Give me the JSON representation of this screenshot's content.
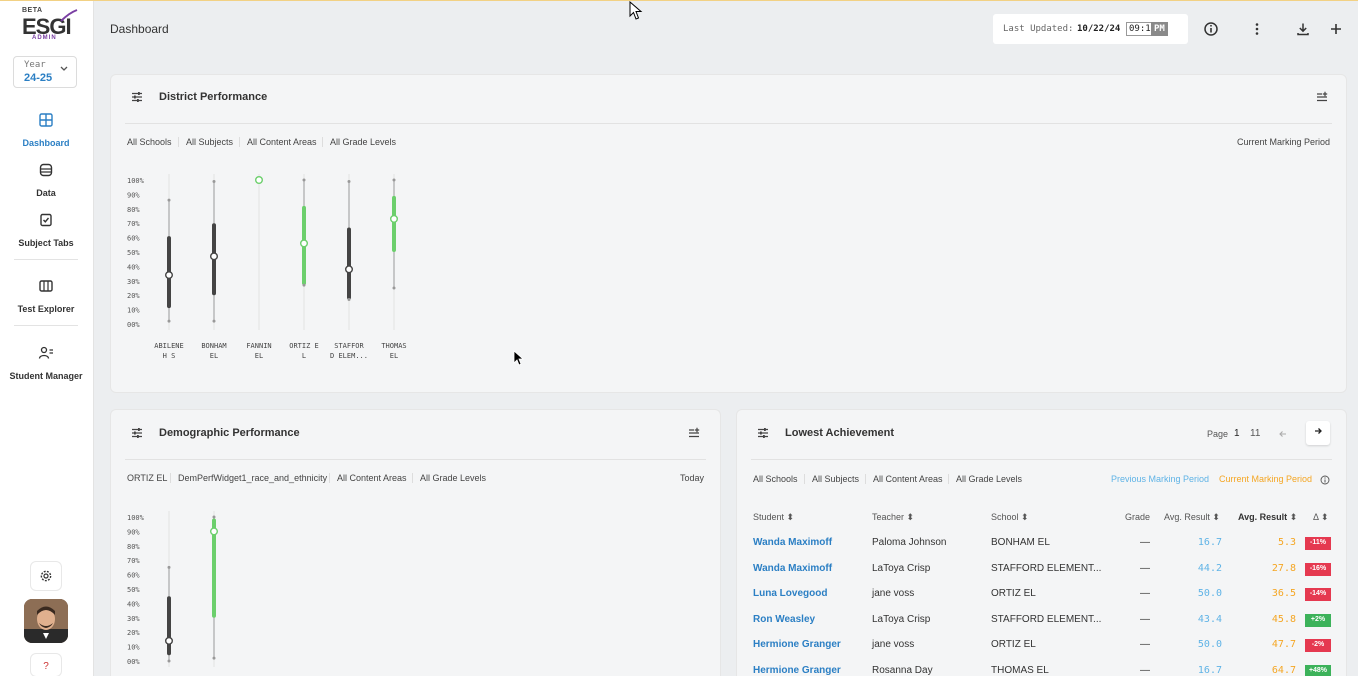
{
  "sidebar": {
    "logo": {
      "beta": "BETA",
      "name": "ESGI",
      "sub": "ADMIN"
    },
    "year": {
      "label": "Year",
      "value": "24-25"
    },
    "items": [
      {
        "label": "Dashboard",
        "icon": "dashboard-icon"
      },
      {
        "label": "Data",
        "icon": "data-icon"
      },
      {
        "label": "Subject Tabs",
        "icon": "subject-tabs-icon"
      },
      {
        "label": "Test Explorer",
        "icon": "test-explorer-icon"
      },
      {
        "label": "Student Manager",
        "icon": "student-manager-icon"
      }
    ],
    "help": "?"
  },
  "header": {
    "title": "Dashboard",
    "last_updated_label": "Last Updated:",
    "date": "10/22/24",
    "time": "09:19",
    "ampm": "PM"
  },
  "district": {
    "title": "District Performance",
    "filters": [
      "All Schools",
      "All Subjects",
      "All Content Areas",
      "All Grade Levels"
    ],
    "period": "Current Marking Period"
  },
  "demographic": {
    "title": "Demographic Performance",
    "filters": [
      "ORTIZ EL",
      "DemPerfWidget1_race_and_ethnicity",
      "All Content Areas",
      "All Grade Levels"
    ],
    "period": "Today"
  },
  "lowest": {
    "title": "Lowest Achievement",
    "page_label": "Page",
    "page": "1",
    "total_pages": "11",
    "filters": [
      "All Schools",
      "All Subjects",
      "All Content Areas",
      "All Grade Levels"
    ],
    "prev_period": "Previous Marking Period",
    "curr_period": "Current Marking Period",
    "columns": [
      "Student",
      "Teacher",
      "School",
      "Grade",
      "Avg. Result",
      "Avg. Result",
      "Δ"
    ],
    "rows": [
      {
        "student": "Wanda Maximoff",
        "teacher": "Paloma Johnson",
        "school": "BONHAM EL",
        "grade": "—",
        "prev": "16.7",
        "curr": "5.3",
        "delta": "-11%"
      },
      {
        "student": "Wanda Maximoff",
        "teacher": "LaToya Crisp",
        "school": "STAFFORD ELEMENT...",
        "grade": "—",
        "prev": "44.2",
        "curr": "27.8",
        "delta": "-16%"
      },
      {
        "student": "Luna Lovegood",
        "teacher": "jane voss",
        "school": "ORTIZ EL",
        "grade": "—",
        "prev": "50.0",
        "curr": "36.5",
        "delta": "-14%"
      },
      {
        "student": "Ron Weasley",
        "teacher": "LaToya Crisp",
        "school": "STAFFORD ELEMENT...",
        "grade": "—",
        "prev": "43.4",
        "curr": "45.8",
        "delta": "+2%"
      },
      {
        "student": "Hermione Granger",
        "teacher": "jane voss",
        "school": "ORTIZ EL",
        "grade": "—",
        "prev": "50.0",
        "curr": "47.7",
        "delta": "-2%"
      },
      {
        "student": "Hermione Granger",
        "teacher": "Rosanna Day",
        "school": "THOMAS EL",
        "grade": "—",
        "prev": "16.7",
        "curr": "64.7",
        "delta": "+48%"
      }
    ]
  },
  "colors": {
    "accent": "#2b7fc4",
    "green": "#6ccf6c",
    "dark": "#444444",
    "orange": "#f5a623",
    "neg": "#e53950",
    "pos": "#3cb25a"
  },
  "chart_data": [
    {
      "type": "box",
      "y_ticks": [
        "100%",
        "90%",
        "80%",
        "70%",
        "60%",
        "50%",
        "40%",
        "30%",
        "20%",
        "10%",
        "00%"
      ],
      "ylim": [
        0,
        100
      ],
      "categories": [
        "ABILENE H S",
        "BONHAM EL",
        "FANNIN EL",
        "ORTIZ E L",
        "STAFFOR D ELEM...",
        "THOMAS EL"
      ],
      "category_lines": [
        [
          "ABILENE",
          "H S"
        ],
        [
          "BONHAM",
          "EL"
        ],
        [
          "FANNIN",
          "EL"
        ],
        [
          "ORTIZ E",
          "L"
        ],
        [
          "STAFFOR",
          "D ELEM..."
        ],
        [
          "THOMAS",
          "EL"
        ]
      ],
      "boxes": [
        {
          "min": 2,
          "q1": 11,
          "median": 34,
          "q3": 61,
          "max": 86,
          "color": "dark"
        },
        {
          "min": 2,
          "q1": 20,
          "median": 47,
          "q3": 70,
          "max": 99,
          "color": "dark"
        },
        {
          "min": 100,
          "q1": 100,
          "median": 100,
          "q3": 100,
          "max": 100,
          "color": "green"
        },
        {
          "min": 27,
          "q1": 27,
          "median": 56,
          "q3": 82,
          "max": 100,
          "color": "green"
        },
        {
          "min": 17,
          "q1": 17,
          "median": 38,
          "q3": 67,
          "max": 99,
          "color": "dark"
        },
        {
          "min": 25,
          "q1": 50,
          "median": 73,
          "q3": 89,
          "max": 100,
          "color": "green"
        }
      ]
    },
    {
      "type": "box",
      "y_ticks": [
        "100%",
        "90%",
        "80%",
        "70%",
        "60%",
        "50%",
        "40%",
        "30%",
        "20%",
        "10%",
        "00%"
      ],
      "ylim": [
        0,
        100
      ],
      "categories": [
        "",
        ""
      ],
      "boxes": [
        {
          "min": 0,
          "q1": 4,
          "median": 14,
          "q3": 45,
          "max": 65,
          "color": "dark"
        },
        {
          "min": 2,
          "q1": 30,
          "median": 90,
          "q3": 99,
          "max": 100,
          "color": "green"
        }
      ]
    }
  ]
}
